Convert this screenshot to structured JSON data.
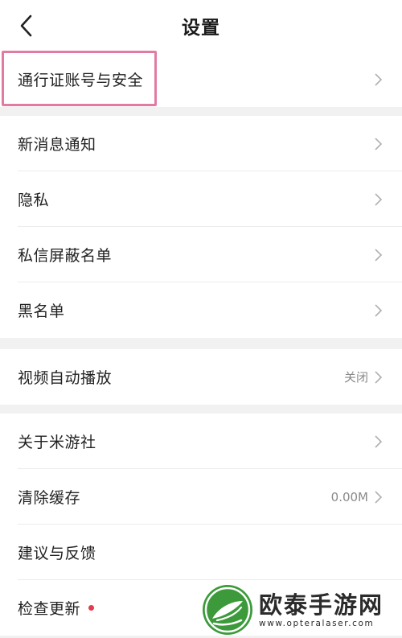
{
  "header": {
    "title": "设置"
  },
  "groups": [
    {
      "items": [
        {
          "label": "通行证账号与安全",
          "value": ""
        }
      ]
    },
    {
      "items": [
        {
          "label": "新消息通知",
          "value": ""
        },
        {
          "label": "隐私",
          "value": ""
        },
        {
          "label": "私信屏蔽名单",
          "value": ""
        },
        {
          "label": "黑名单",
          "value": ""
        }
      ]
    },
    {
      "items": [
        {
          "label": "视频自动播放",
          "value": "关闭"
        }
      ]
    },
    {
      "items": [
        {
          "label": "关于米游社",
          "value": ""
        },
        {
          "label": "清除缓存",
          "value": "0.00M"
        },
        {
          "label": "建议与反馈",
          "value": ""
        },
        {
          "label": "检查更新",
          "value": ""
        }
      ]
    }
  ],
  "watermark": {
    "name": "欧泰手游网",
    "url": "www.opteralaser.com"
  },
  "colors": {
    "highlight": "#e27ba3",
    "update_dot": "#e33b4b",
    "logo_green": "#3c9a3a"
  },
  "icons": {
    "back": "chevron-left-icon",
    "row_arrow": "chevron-right-icon",
    "update": "red-dot-badge"
  }
}
